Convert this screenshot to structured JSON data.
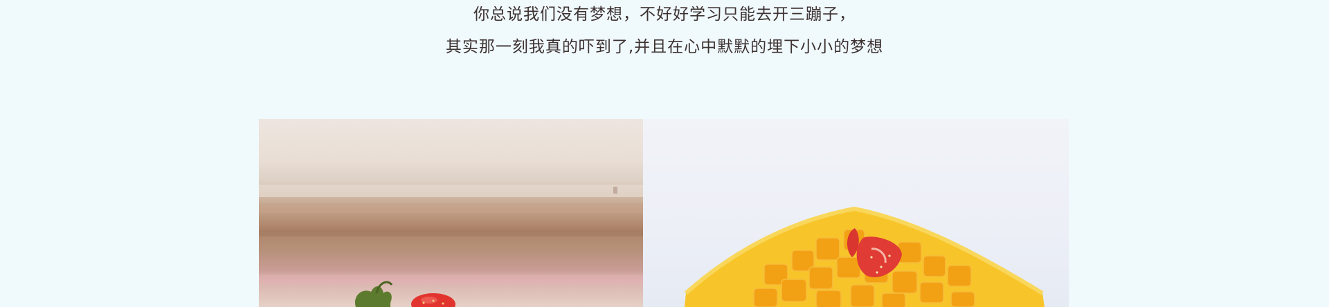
{
  "intro": {
    "line1": "你总说我们没有梦想，不好好学习只能去开三蹦子，",
    "line2": "其实那一刻我真的吓到了,并且在心中默默的埋下小小的梦想"
  },
  "colors": {
    "page_background": "#f0f9fc",
    "text": "#3d3232",
    "mango": "#f7b61e",
    "strawberry": "#e2342f"
  },
  "gallery": {
    "left_photo": {
      "icon": "strawberry-dessert-photo"
    },
    "right_photo": {
      "icon": "mango-cake-photo"
    }
  }
}
